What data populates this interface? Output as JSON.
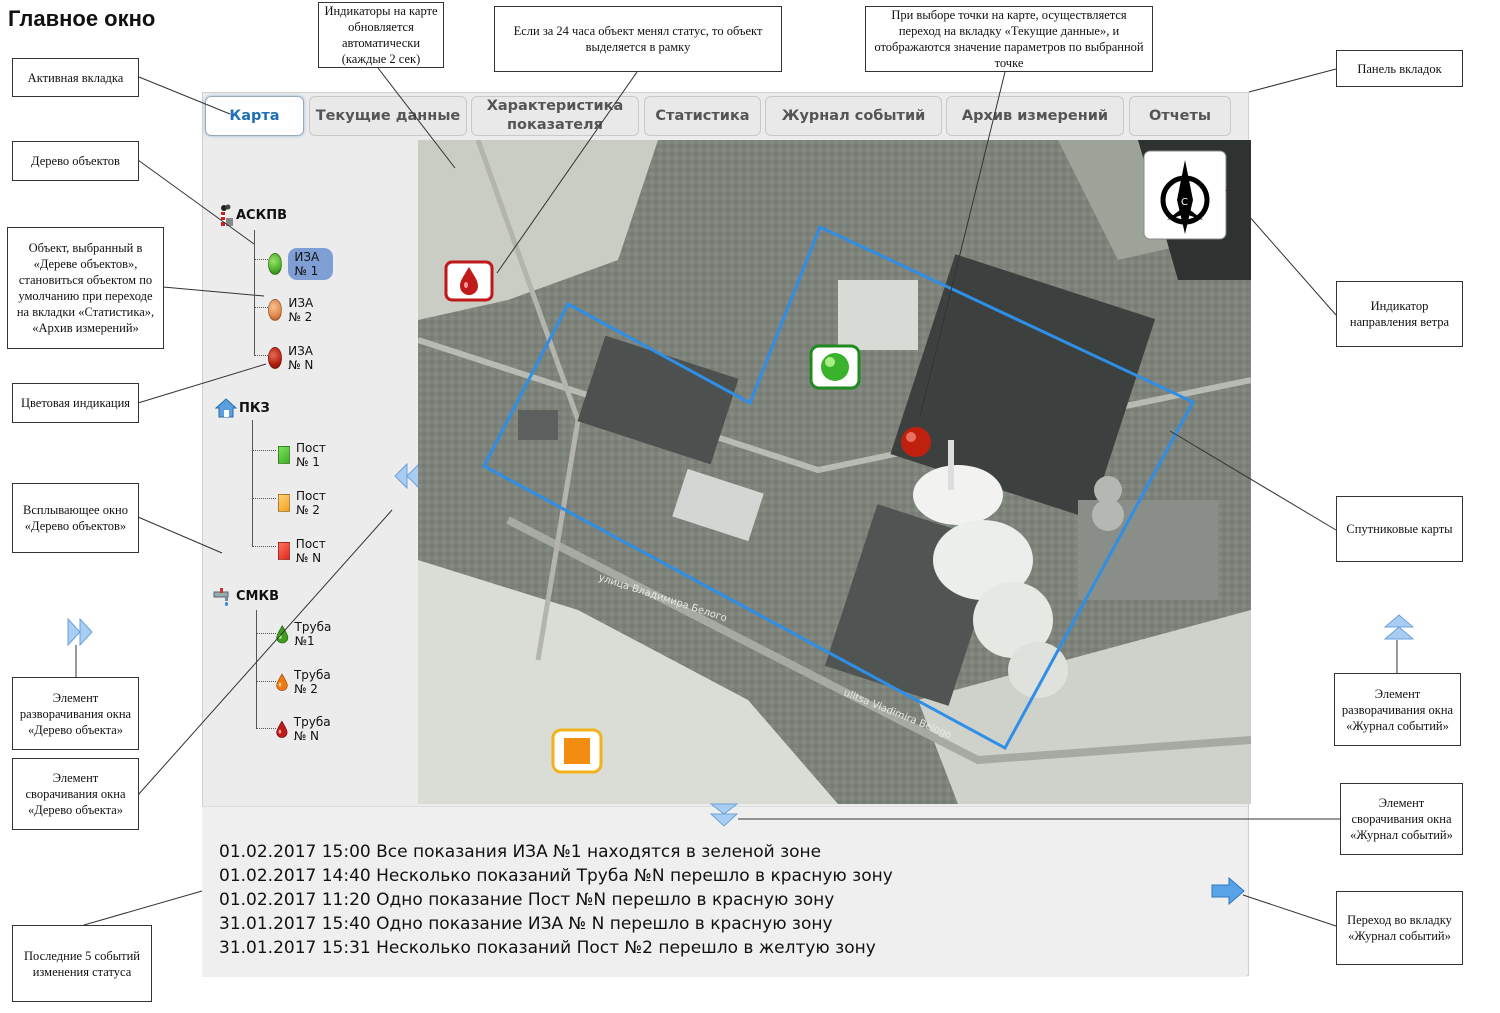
{
  "page_title": "Главное окно",
  "tabs": [
    {
      "label": "Карта",
      "active": true
    },
    {
      "label": "Текущие данные"
    },
    {
      "label": "Характеристика показателя"
    },
    {
      "label": "Статистика"
    },
    {
      "label": "Журнал событий"
    },
    {
      "label": "Архив измерений"
    },
    {
      "label": "Отчеты"
    }
  ],
  "tree": {
    "askpv": {
      "title": "АСКПВ",
      "items": [
        {
          "label": "ИЗА № 1",
          "color": "#4caf2a"
        },
        {
          "label": "ИЗА № 2",
          "color": "#e0864a"
        },
        {
          "label": "ИЗА № N",
          "color": "#b5200e"
        }
      ]
    },
    "pkz": {
      "title": "ПКЗ",
      "items": [
        {
          "label": "Пост № 1",
          "color": "#3db02a"
        },
        {
          "label": "Пост № 2",
          "color": "#f5a020"
        },
        {
          "label": "Пост № N",
          "color": "#e02a1c"
        }
      ]
    },
    "smkv": {
      "title": "СМКВ",
      "items": [
        {
          "label": "Труба №1",
          "color": "#3f9e1c"
        },
        {
          "label": "Труба № 2",
          "color": "#f07a10"
        },
        {
          "label": "Труба № N",
          "color": "#c11a1a"
        }
      ]
    }
  },
  "map": {
    "streets": [
      "улица Владимира Белого",
      "ulitsa Vladimira Belogo"
    ],
    "wind_letter": "С"
  },
  "log": [
    "01.02.2017 15:00 Все показания ИЗА №1 находятся в зеленой зоне",
    "01.02.2017 14:40 Несколько показаний Труба №N перешло в красную зону",
    "01.02.2017 11:20 Одно показание Пост №N перешло в красную зону",
    "31.01.2017 15:40 Одно показание ИЗА № N перешло в красную зону",
    "31.01.2017 15:31 Несколько показаний  Пост №2 перешло в желтую зону"
  ],
  "callouts": {
    "active_tab": "Активная вкладка",
    "indicators": "Индикаторы на карте обновляется автоматически (каждые 2 сек)",
    "status_frame": "Если за 24 часа объект менял статус, то объект выделяется в рамку",
    "point_select": "При выборе точки на карте, осуществляется переход на вкладку «Текущие данные», и отображаются значение параметров по выбранной точке",
    "tab_panel": "Панель вкладок",
    "object_tree": "Дерево объектов",
    "selected_object": "Объект, выбранный в «Дереве объектов», становиться объектом по умолчанию при переходе на вкладки «Статистика», «Архив измерений»",
    "color_indication": "Цветовая индикация",
    "popup_tree": "Всплывающее окно «Дерево объектов»",
    "expand_tree": "Элемент разворачивания окна «Дерево объекта»",
    "collapse_tree": "Элемент сворачивания окна «Дерево объекта»",
    "last_events": "Последние 5 событий изменения статуса",
    "wind": "Индикатор направления ветра",
    "satellite": "Спутниковые карты",
    "expand_log": "Элемент разворачивания окна «Журнал событий»",
    "collapse_log": "Элемент сворачивания окна «Журнал событий»",
    "goto_log": "Переход во вкладку «Журнал событий»"
  }
}
